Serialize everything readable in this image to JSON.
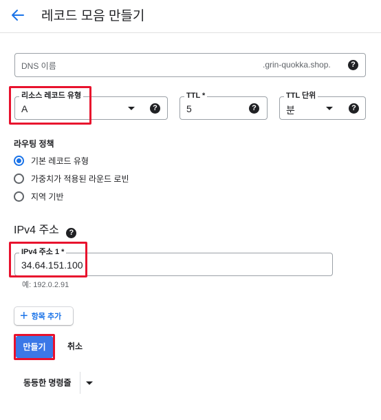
{
  "header": {
    "title": "레코드 모음 만들기"
  },
  "dns_name": {
    "placeholder": "DNS 이름",
    "suffix": ".grin-quokka.shop."
  },
  "record_type": {
    "label": "리소스 레코드 유형",
    "value": "A"
  },
  "ttl": {
    "label": "TTL *",
    "value": "5"
  },
  "ttl_unit": {
    "label": "TTL 단위",
    "value": "분"
  },
  "routing": {
    "title": "라우팅 정책",
    "options": [
      {
        "label": "기본 레코드 유형",
        "selected": true
      },
      {
        "label": "가중치가 적용된 라운드 로빈",
        "selected": false
      },
      {
        "label": "지역 기반",
        "selected": false
      }
    ]
  },
  "ipv4": {
    "heading": "IPv4 주소",
    "field_label": "IPv4 주소 1 *",
    "value": "34.64.151.100",
    "hint": "예: 192.0.2.91"
  },
  "actions": {
    "add_item": "항목 추가",
    "create": "만들기",
    "cancel": "취소",
    "equivalent_command": "동등한 명령줄"
  },
  "colors": {
    "accent": "#1a73e8",
    "primary_button": "#3b78e7",
    "highlight": "#e8112d"
  },
  "icons": {
    "back": "arrow-left",
    "help": "question-circle",
    "dropdown": "caret-down",
    "add": "plus"
  }
}
